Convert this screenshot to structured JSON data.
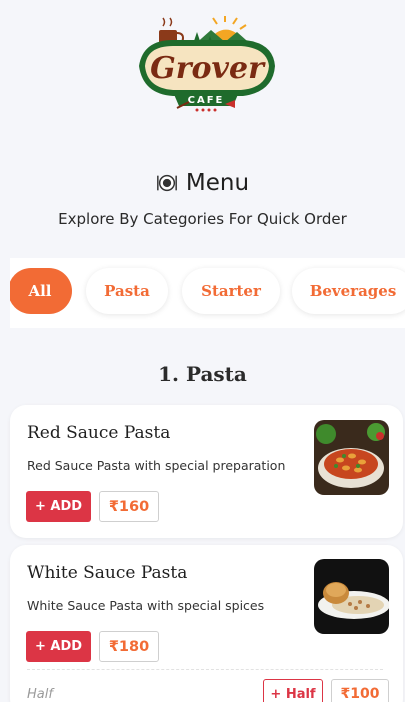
{
  "brand": {
    "name": "Grover",
    "tagline": "CAFE"
  },
  "header": {
    "title": "Menu",
    "subtitle": "Explore By Categories For Quick Order"
  },
  "categories": [
    {
      "label": "All",
      "active": true
    },
    {
      "label": "Pasta",
      "active": false
    },
    {
      "label": "Starter",
      "active": false
    },
    {
      "label": "Beverages",
      "active": false
    }
  ],
  "section": {
    "title": "1. Pasta"
  },
  "items": [
    {
      "name": "Red Sauce Pasta",
      "description": "Red Sauce Pasta with special preparation",
      "add_label": "+ ADD",
      "price": "₹160"
    },
    {
      "name": "White Sauce Pasta",
      "description": "White Sauce Pasta with special spices",
      "add_label": "+ ADD",
      "price": "₹180",
      "variant": {
        "label": "Half",
        "button_label": "+ Half",
        "price": "₹100"
      }
    }
  ],
  "colors": {
    "accent": "#f26b35",
    "add": "#dc3545",
    "background": "#f5f6fa"
  }
}
